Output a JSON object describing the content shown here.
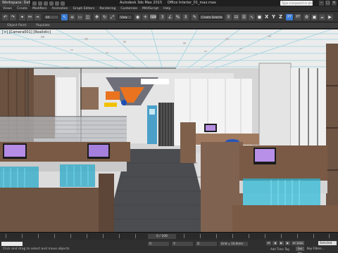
{
  "titlebar": {
    "workspace": "Workspace: Default",
    "app_title": "Autodesk 3ds Max 2015",
    "file_name": "Office Interior_01_max.max",
    "search_placeholder": "Type a keyword or phrase",
    "controls": [
      "–",
      "□",
      "✕"
    ]
  },
  "menubar": {
    "items": [
      "Views",
      "Create",
      "Modifiers",
      "Animation",
      "Graph Editors",
      "Rendering",
      "Customize",
      "MAXScript",
      "Help"
    ]
  },
  "toolbar": {
    "selection_filter": "All",
    "reference_coordinate": "View",
    "named_selection_placeholder": "Create Selection Se",
    "axis_letters": [
      "X",
      "Y",
      "Z",
      "XY",
      "XY"
    ]
  },
  "ribbon": {
    "tabs": [
      "Object Paint",
      "Populate"
    ]
  },
  "viewport": {
    "label": "[+] [Camera001] [Realistic]",
    "scene": "office interior render"
  },
  "timeline": {
    "frame_counter": "0 / 100"
  },
  "statusbar": {
    "status_text": "Click and drag to select and move objects",
    "coords": {
      "x": "X:",
      "y": "Y:",
      "z": "Z:"
    },
    "grid": "Grid = 10.0mm",
    "add_time_tag": "Add Time Tag",
    "auto_key": "Auto Key",
    "set_key": "Set Key",
    "key_filters": "Key Filters...",
    "selected": "Selected"
  },
  "colors": {
    "accent": "#3a7bd5",
    "monitor_glow": "#c19aff",
    "chair_cyan": "#1ecbe6",
    "wood": "#7a5a45",
    "orange": "#e9731f"
  }
}
